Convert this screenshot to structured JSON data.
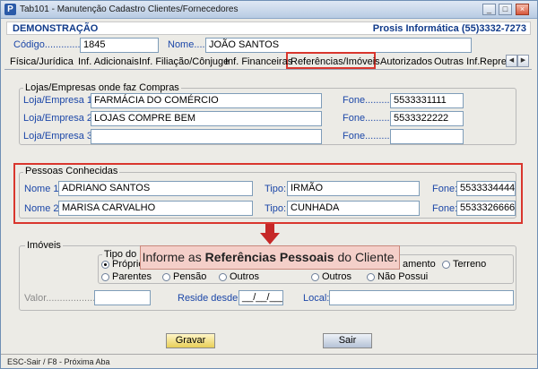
{
  "window": {
    "title": "Tab101 - Manutenção Cadastro Clientes/Fornecedores",
    "minimize": "_",
    "maximize": "□",
    "close": "×"
  },
  "header": {
    "left": "DEMONSTRAÇÃO",
    "right": "Prosis Informática (55)3332-7273"
  },
  "codigo": {
    "label": "Código.............",
    "value": "1845"
  },
  "nome": {
    "label": "Nome.....:",
    "value": "JOÃO SANTOS"
  },
  "tabs": [
    "Física/Jurídica",
    "Inf. Adicionais",
    "Inf. Filiação/Cônjuge",
    "Inf. Financeiras",
    "Referências/Imóveis",
    "Autorizados",
    "Outras Inf.",
    "Repre"
  ],
  "scroll": {
    "left": "◀",
    "right": "▶"
  },
  "lojas": {
    "title": "Lojas/Empresas onde faz Compras",
    "rows": [
      {
        "label": "Loja/Empresa 1:",
        "value": "FARMÁCIA DO COMÉRCIO",
        "fone_label": "Fone.........:",
        "fone": "5533331111"
      },
      {
        "label": "Loja/Empresa 2:",
        "value": "LOJAS COMPRE BEM",
        "fone_label": "Fone.........:",
        "fone": "5533322222"
      },
      {
        "label": "Loja/Empresa 3:",
        "value": "",
        "fone_label": "Fone.........:",
        "fone": ""
      }
    ]
  },
  "pessoas": {
    "title": "Pessoas Conhecidas",
    "rows": [
      {
        "label": "Nome 1:",
        "value": "ADRIANO SANTOS",
        "tipo_label": "Tipo:",
        "tipo": "IRMÃO",
        "fone_label": "Fone:",
        "fone": "5533334444"
      },
      {
        "label": "Nome 2:",
        "value": "MARISA CARVALHO",
        "tipo_label": "Tipo:",
        "tipo": "CUNHADA",
        "fone_label": "Fone:",
        "fone": "5533326666"
      }
    ]
  },
  "tooltip": {
    "pre": "Informe as ",
    "bold": "Referências Pessoais",
    "post": " do Cliente."
  },
  "imoveis": {
    "title": "Imóveis",
    "tipo_title": "Tipo do Im",
    "r1": "Próprio",
    "r2": "Parentes",
    "r3": "Pensão",
    "r4": "Outros",
    "r5": "amento",
    "r6": "Terreno",
    "r7": "Outros",
    "r8": "Não Possui",
    "valor_label": "Valor.....................:",
    "reside_label": "Reside desde:",
    "reside_value": "__/__/____",
    "local_label": "Local:"
  },
  "buttons": {
    "gravar": "Gravar",
    "sair": "Sair"
  },
  "status": "ESC-Sair / F8 - Próxima Aba"
}
